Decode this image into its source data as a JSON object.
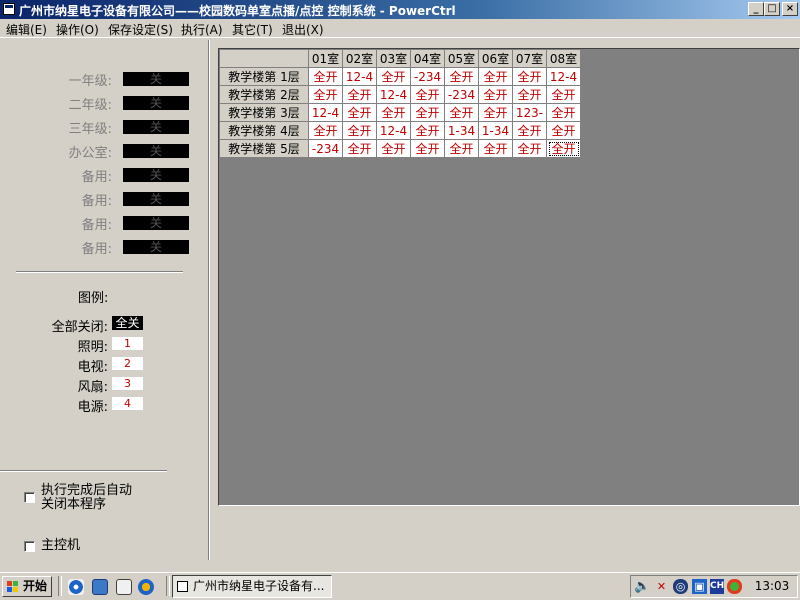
{
  "window": {
    "title": "广州市纳星电子设备有限公司——校园数码单室点播/点控 控制系统 - PowerCtrl",
    "buttons": {
      "minimize": "_",
      "maximize": "□",
      "close": "×"
    }
  },
  "menu": [
    "编辑(E)",
    "操作(O)",
    "保存设定(S)",
    "执行(A)",
    "其它(T)",
    "退出(X)"
  ],
  "floors": [
    {
      "label": "一年级:",
      "status": "关"
    },
    {
      "label": "二年级:",
      "status": "关"
    },
    {
      "label": "三年级:",
      "status": "关"
    },
    {
      "label": "办公室:",
      "status": "关"
    },
    {
      "label": "备用:",
      "status": "关"
    },
    {
      "label": "备用:",
      "status": "关"
    },
    {
      "label": "备用:",
      "status": "关"
    },
    {
      "label": "备用:",
      "status": "关"
    }
  ],
  "legend": {
    "title": "图例:",
    "items": [
      {
        "label": "全部关闭:",
        "value": "全关"
      },
      {
        "label": "照明:",
        "value": "1"
      },
      {
        "label": "电视:",
        "value": "2"
      },
      {
        "label": "风扇:",
        "value": "3"
      },
      {
        "label": "电源:",
        "value": "4"
      }
    ]
  },
  "options": {
    "auto_close_line1": "执行完成后自动",
    "auto_close_line2": "关闭本程序",
    "master": "主控机"
  },
  "grid": {
    "columns": [
      "01室",
      "02室",
      "03室",
      "04室",
      "05室",
      "06室",
      "07室",
      "08室"
    ],
    "rows": [
      {
        "label": "教学楼第  1层",
        "cells": [
          "全开",
          "12-4",
          "全开",
          "-234",
          "全开",
          "全开",
          "全开",
          "12-4"
        ]
      },
      {
        "label": "教学楼第  2层",
        "cells": [
          "全开",
          "全开",
          "12-4",
          "全开",
          "-234",
          "全开",
          "全开",
          "全开"
        ]
      },
      {
        "label": "教学楼第  3层",
        "cells": [
          "12-4",
          "全开",
          "全开",
          "全开",
          "全开",
          "全开",
          "123-",
          "全开"
        ]
      },
      {
        "label": "教学楼第  4层",
        "cells": [
          "全开",
          "全开",
          "12-4",
          "全开",
          "1-34",
          "1-34",
          "全开",
          "全开"
        ]
      },
      {
        "label": "教学楼第  5层",
        "cells": [
          "-234",
          "全开",
          "全开",
          "全开",
          "全开",
          "全开",
          "全开",
          "全开"
        ]
      }
    ]
  },
  "taskbar": {
    "start": "开始",
    "task": "广州市纳星电子设备有...",
    "clock": "13:03",
    "tray_lang": "CH"
  }
}
